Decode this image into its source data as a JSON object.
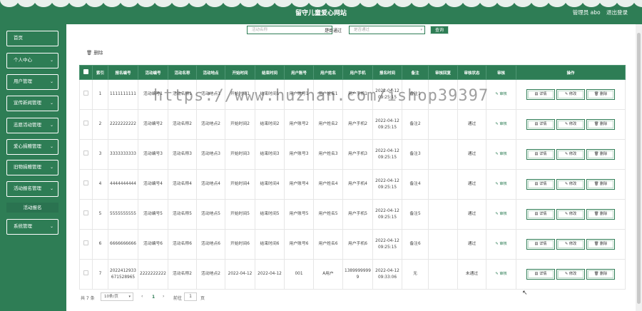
{
  "header": {
    "title": "留守儿童爱心网站",
    "admin_label": "管理员 abo",
    "logout": "退出登录"
  },
  "sidebar": {
    "items": [
      {
        "label": "首页",
        "chevron": ""
      },
      {
        "label": "个人中心",
        "chevron": "⌄"
      },
      {
        "label": "用户管理",
        "chevron": "⌄"
      },
      {
        "label": "宣传新闻管理",
        "chevron": "⌄"
      },
      {
        "label": "志愿活动管理",
        "chevron": "⌄"
      },
      {
        "label": "爱心捐赠管理",
        "chevron": "⌄"
      },
      {
        "label": "旧物捐赠管理",
        "chevron": "⌄"
      },
      {
        "label": "活动报名管理",
        "chevron": "⌄"
      },
      {
        "label": "系统管理",
        "chevron": "⌄"
      }
    ],
    "submenu": {
      "label": "活动报名"
    }
  },
  "search": {
    "name_placeholder": "活动名称",
    "status_label": "是否通过",
    "status_placeholder": "是否通过",
    "button": "查询"
  },
  "toolbar": {
    "delete_label": "删除",
    "delete_icon": "trash-icon"
  },
  "table": {
    "headers": [
      "索引",
      "报名编号",
      "活动编号",
      "活动名称",
      "活动地点",
      "开始时间",
      "结束时间",
      "用户账号",
      "用户姓名",
      "用户手机",
      "报名时间",
      "备注",
      "审核回复",
      "审核状态",
      "审核",
      "操作"
    ],
    "rows": [
      {
        "index": "1",
        "reg_no": "1111111111",
        "act_no": "活动编号1",
        "act_name": "活动名称1",
        "location": "活动地点1",
        "start": "开始时间1",
        "end": "结束时间1",
        "account": "用户账号1",
        "uname": "用户姓名1",
        "phone": "用户手机1",
        "reg_time": "2022-04-12 09:25:15",
        "remark": "备注1",
        "reply": "",
        "status": ""
      },
      {
        "index": "2",
        "reg_no": "2222222222",
        "act_no": "活动编号2",
        "act_name": "活动名称2",
        "location": "活动地点2",
        "start": "开始时间2",
        "end": "结束时间2",
        "account": "用户账号2",
        "uname": "用户姓名2",
        "phone": "用户手机2",
        "reg_time": "2022-04-12 09:25:15",
        "remark": "备注2",
        "reply": "",
        "status": "通过"
      },
      {
        "index": "3",
        "reg_no": "3333333333",
        "act_no": "活动编号3",
        "act_name": "活动名称3",
        "location": "活动地点3",
        "start": "开始时间3",
        "end": "结束时间3",
        "account": "用户账号3",
        "uname": "用户姓名3",
        "phone": "用户手机3",
        "reg_time": "2022-04-12 09:25:15",
        "remark": "备注3",
        "reply": "",
        "status": "通过"
      },
      {
        "index": "4",
        "reg_no": "4444444444",
        "act_no": "活动编号4",
        "act_name": "活动名称4",
        "location": "活动地点4",
        "start": "开始时间4",
        "end": "结束时间4",
        "account": "用户账号4",
        "uname": "用户姓名4",
        "phone": "用户手机4",
        "reg_time": "2022-04-12 09:25:15",
        "remark": "备注4",
        "reply": "",
        "status": "通过"
      },
      {
        "index": "5",
        "reg_no": "5555555555",
        "act_no": "活动编号5",
        "act_name": "活动名称5",
        "location": "活动地点5",
        "start": "开始时间5",
        "end": "结束时间5",
        "account": "用户账号5",
        "uname": "用户姓名5",
        "phone": "用户手机5",
        "reg_time": "2022-04-12 09:25:15",
        "remark": "备注5",
        "reply": "",
        "status": "通过"
      },
      {
        "index": "6",
        "reg_no": "6666666666",
        "act_no": "活动编号6",
        "act_name": "活动名称6",
        "location": "活动地点6",
        "start": "开始时间6",
        "end": "结束时间6",
        "account": "用户账号6",
        "uname": "用户姓名6",
        "phone": "用户手机6",
        "reg_time": "2022-04-12 09:25:15",
        "remark": "备注6",
        "reply": "",
        "status": "通过"
      },
      {
        "index": "7",
        "reg_no": "2022412933671528965",
        "act_no": "2222222222",
        "act_name": "活动名称2",
        "location": "活动地点2",
        "start": "2022-04-12",
        "end": "2022-04-12",
        "account": "001",
        "uname": "A用户",
        "phone": "13899999999",
        "reg_time": "2022-04-12 09:33:06",
        "remark": "无",
        "reply": "",
        "status": "未通过"
      }
    ],
    "audit_label": "审核",
    "detail_label": "详情",
    "edit_label": "修改",
    "delete_label": "删除"
  },
  "pager": {
    "total": "共 7 条",
    "page_size": "10条/页",
    "prev": "‹",
    "current": "1",
    "next": "›",
    "goto": "前往",
    "jump_value": "1",
    "page_unit": "页"
  },
  "watermark": "https://www.huzhan.com/ishop39397",
  "colors": {
    "brand": "#2e7d55",
    "background": "#ffffff"
  }
}
